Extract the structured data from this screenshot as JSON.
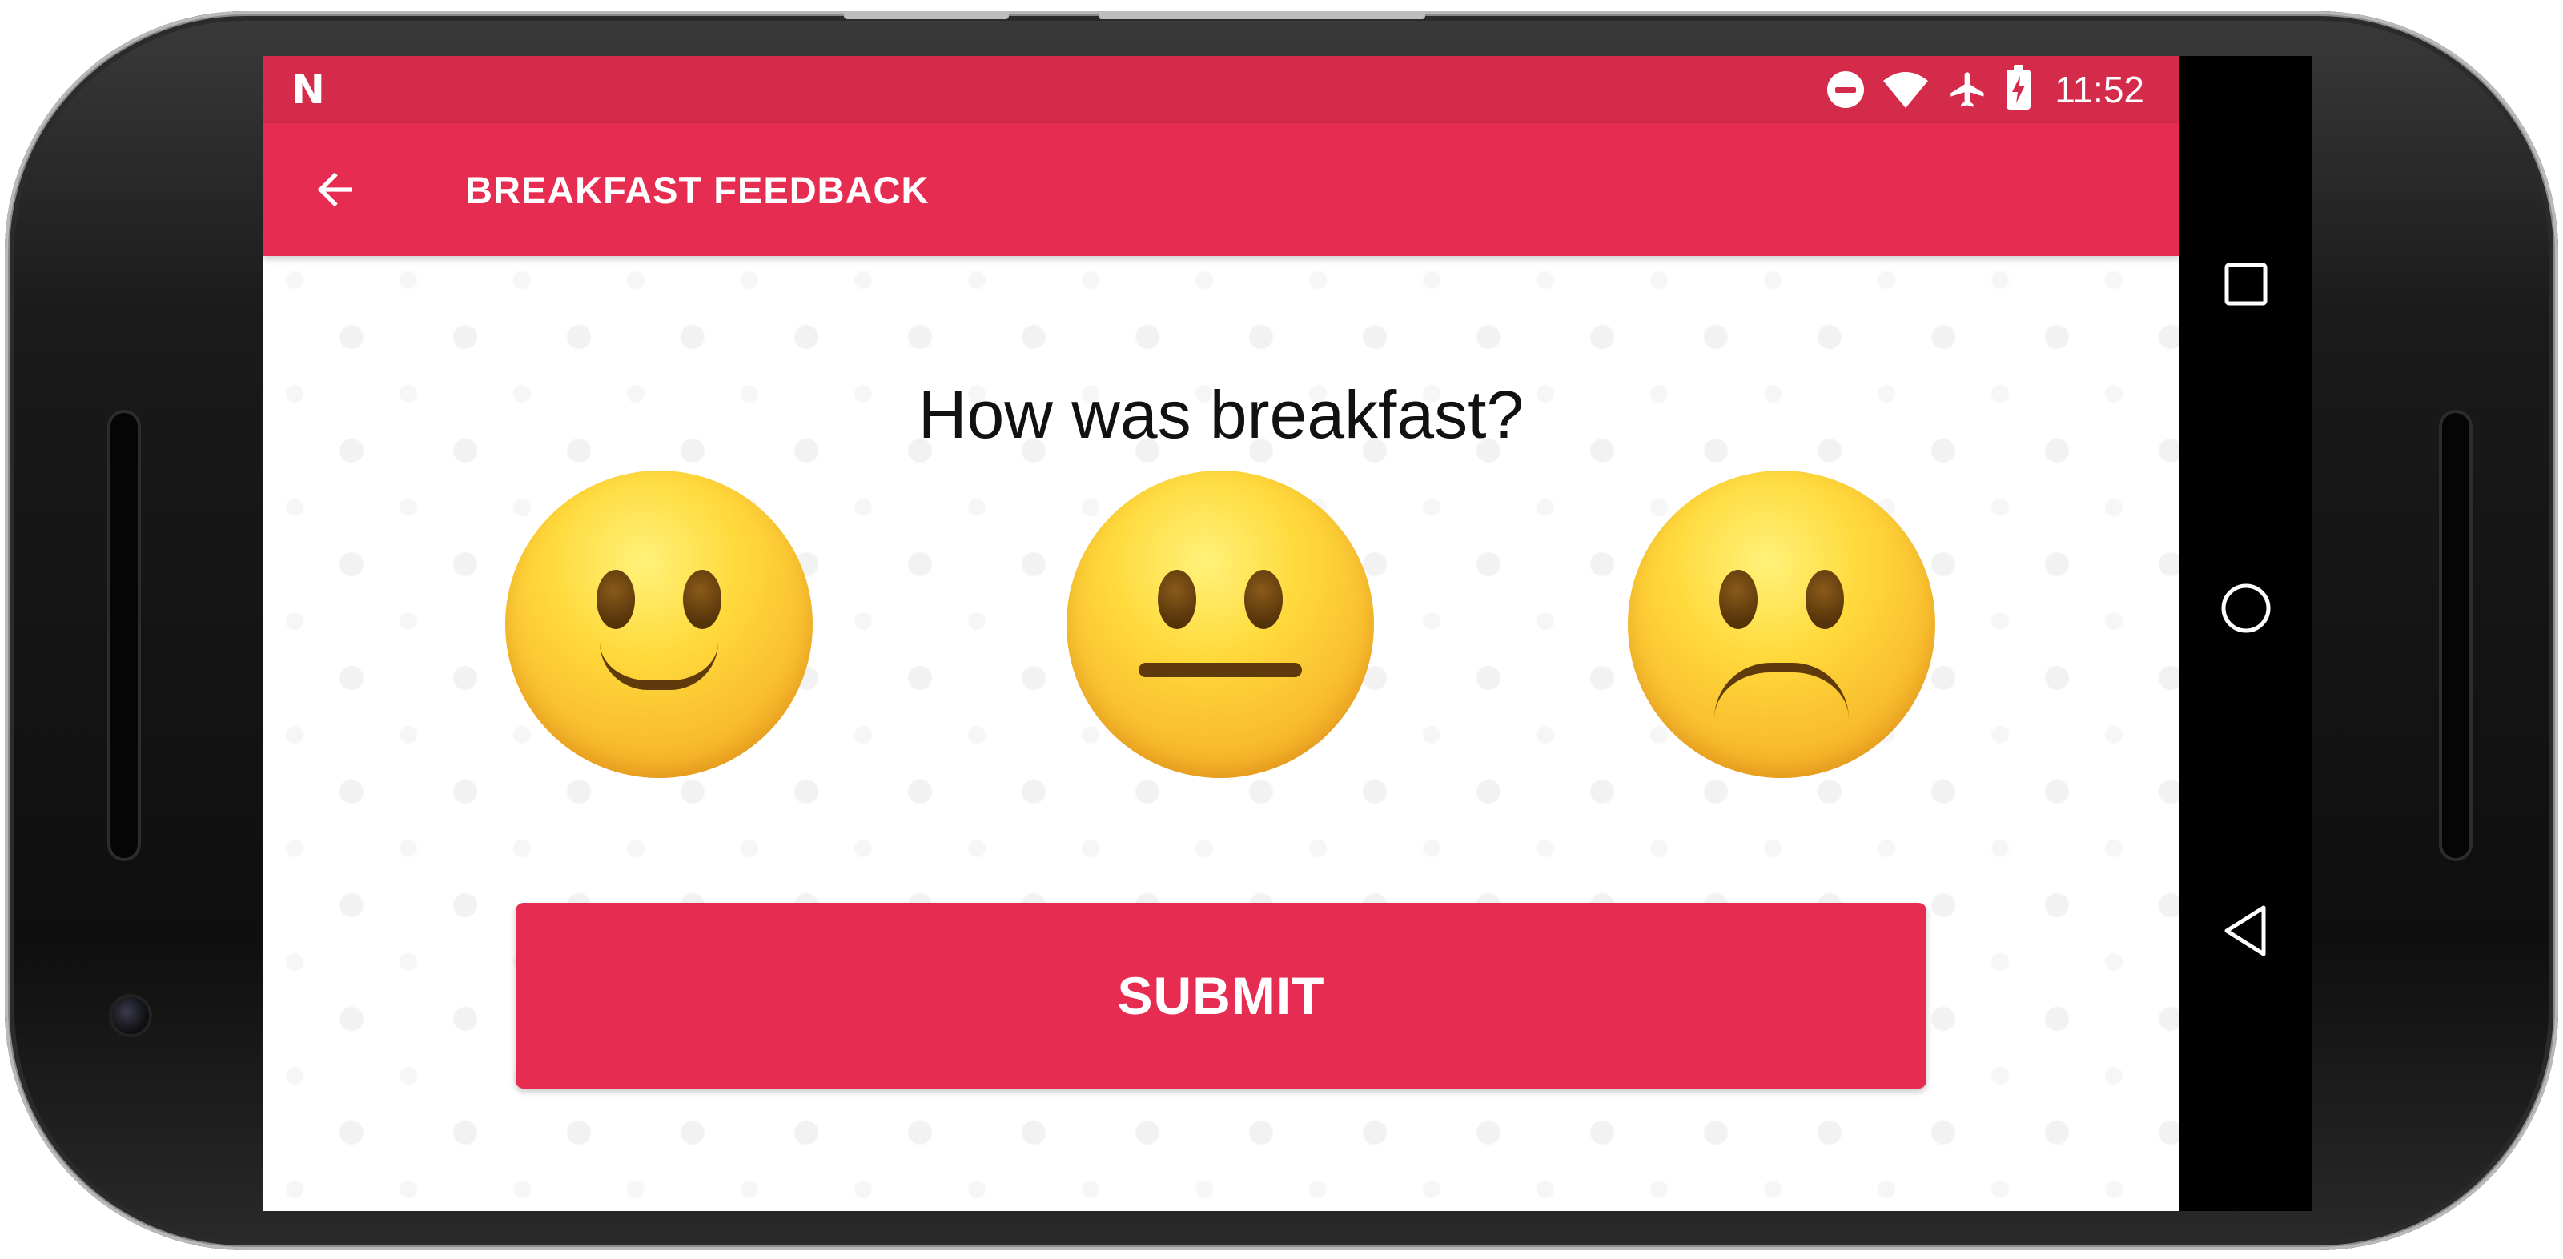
{
  "status_bar": {
    "notification_icon": "N",
    "icons": [
      "do-not-disturb-icon",
      "wifi-icon",
      "airplane-mode-icon",
      "battery-charging-icon"
    ],
    "time": "11:52"
  },
  "app_bar": {
    "back_icon": "arrow-back-icon",
    "title": "BREAKFAST FEEDBACK"
  },
  "feedback": {
    "question": "How was breakfast?",
    "options": [
      {
        "name": "happy",
        "icon": "slightly-smiling-face-icon"
      },
      {
        "name": "neutral",
        "icon": "neutral-face-icon"
      },
      {
        "name": "sad",
        "icon": "slightly-frowning-face-icon"
      }
    ],
    "submit_label": "SUBMIT"
  },
  "nav_bar": {
    "buttons": [
      "recents-square-icon",
      "home-circle-icon",
      "back-triangle-icon"
    ]
  },
  "colors": {
    "status_bar": "#d42b4b",
    "accent": "#e72c52",
    "text_on_accent": "#ffffff",
    "question_text": "#111111",
    "nav_bar": "#000000"
  }
}
